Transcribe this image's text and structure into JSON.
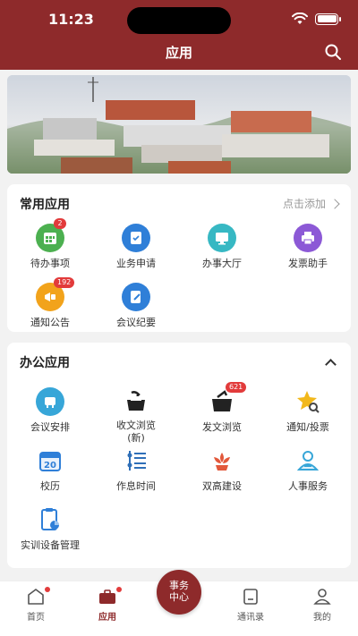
{
  "status": {
    "time": "11:23"
  },
  "header": {
    "title": "应用"
  },
  "common": {
    "title": "常用应用",
    "action": "点击添加",
    "items": [
      {
        "label": "待办事项",
        "badge": "2",
        "icon": "calendar-icon",
        "color": "#4cb050"
      },
      {
        "label": "业务申请",
        "badge": "",
        "icon": "document-check-icon",
        "color": "#2f7fd8"
      },
      {
        "label": "办事大厅",
        "badge": "",
        "icon": "monitor-icon",
        "color": "#37b8c3"
      },
      {
        "label": "发票助手",
        "badge": "",
        "icon": "printer-icon",
        "color": "#8c59d6"
      },
      {
        "label": "通知公告",
        "badge": "192",
        "icon": "megaphone-icon",
        "color": "#f2a31b"
      },
      {
        "label": "会议纪要",
        "badge": "",
        "icon": "note-edit-icon",
        "color": "#2f7fd8"
      }
    ]
  },
  "office": {
    "title": "办公应用",
    "items": [
      {
        "label": "会议安排",
        "badge": "",
        "icon": "meeting-icon",
        "color": "#37a6d8"
      },
      {
        "label": "收文浏览\n(新)",
        "badge": "",
        "icon": "inbox-icon",
        "color": "#222222"
      },
      {
        "label": "发文浏览",
        "badge": "621",
        "icon": "outbox-icon",
        "color": "#222222"
      },
      {
        "label": "通知/投票",
        "badge": "",
        "icon": "star-search-icon",
        "color": "#f2b81b"
      },
      {
        "label": "校历",
        "badge": "",
        "icon": "calendar-20-icon",
        "color": "#2f7fd8"
      },
      {
        "label": "作息时间",
        "badge": "",
        "icon": "schedule-list-icon",
        "color": "#2f6fb8"
      },
      {
        "label": "双高建设",
        "badge": "",
        "icon": "flower-icon",
        "color": "#e2583b"
      },
      {
        "label": "人事服务",
        "badge": "",
        "icon": "person-service-icon",
        "color": "#37a6d8"
      },
      {
        "label": "实训设备管理",
        "badge": "",
        "icon": "clipboard-chart-icon",
        "color": "#2f7fd8"
      }
    ]
  },
  "tabbar": {
    "home": "首页",
    "apps": "应用",
    "center_line1": "事务",
    "center_line2": "中心",
    "contacts": "通讯录",
    "mine": "我的"
  }
}
